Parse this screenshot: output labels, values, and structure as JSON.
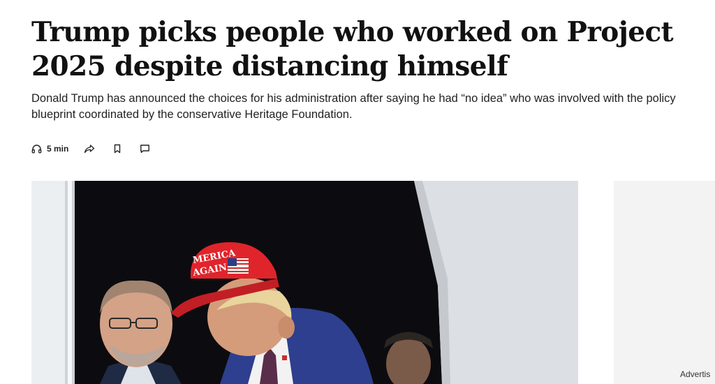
{
  "article": {
    "headline": "Trump picks people who worked on Project 2025 despite distancing himself",
    "dek": "Donald Trump has announced the choices for his administration after saying he had “no idea” who was involved with the policy blueprint coordinated by the conservative Heritage Foundation."
  },
  "toolbar": {
    "listen_label": "5 min",
    "icons": [
      "headphones-icon",
      "share-icon",
      "bookmark-icon",
      "comment-icon"
    ]
  },
  "hero": {
    "cap_text_line1": "MERICA",
    "cap_text_line2": "AGAIN"
  },
  "ad": {
    "label": "Advertis"
  },
  "colors": {
    "cap_red": "#e0242b",
    "suit_blue": "#2d3f8e",
    "background": "#ffffff"
  }
}
